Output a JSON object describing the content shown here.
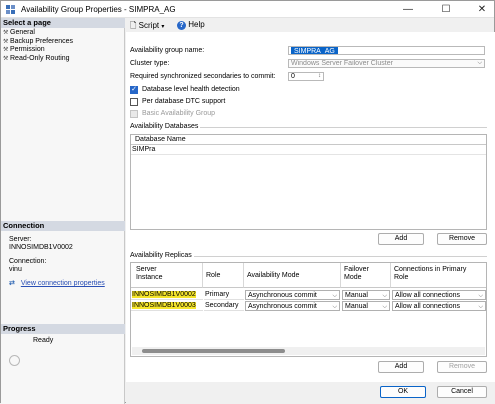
{
  "window": {
    "title": "Availability Group Properties - SIMPRA_AG",
    "minimize": "—",
    "maximize": "☐",
    "close": "✕"
  },
  "left": {
    "select_page_header": "Select a page",
    "pages": [
      {
        "label": "General",
        "icon": "wrench-icon"
      },
      {
        "label": "Backup Preferences",
        "icon": "wrench-icon"
      },
      {
        "label": "Permission",
        "icon": "wrench-icon"
      },
      {
        "label": "Read-Only Routing",
        "icon": "wrench-icon"
      }
    ],
    "connection_header": "Connection",
    "server_label": "Server:",
    "server_value": "INNOSIMDB1V0002",
    "connection_label": "Connection:",
    "connection_value": "vinu",
    "view_conn_link": "View connection properties",
    "progress_header": "Progress",
    "progress_status": "Ready"
  },
  "toolbar": {
    "script_label": "Script",
    "help_label": "Help"
  },
  "general": {
    "ag_name_label": "Availability group name:",
    "ag_name_value": "SIMPRA_AG",
    "cluster_type_label": "Cluster type:",
    "cluster_type_value": "Windows Server Failover Cluster",
    "req_sync_label": "Required synchronized secondaries to commit:",
    "req_sync_value": "0",
    "db_health_label": "Database level health detection",
    "db_health_checked": true,
    "dtc_label": "Per database DTC support",
    "dtc_checked": false,
    "basic_ag_label": "Basic Availability Group",
    "basic_ag_checked": false
  },
  "databases": {
    "section_label": "Availability Databases",
    "column": "Database Name",
    "rows": [
      "SIMPra"
    ],
    "add_button": "Add",
    "remove_button": "Remove"
  },
  "replicas": {
    "section_label": "Availability Replicas",
    "headers": {
      "server_instance": "Server\nInstance",
      "role": "Role",
      "availability_mode": "Availability Mode",
      "failover_mode": "Failover\nMode",
      "connections": "Connections in Primary\nRole"
    },
    "rows": [
      {
        "server": "INNOSIMDB1V0002",
        "role": "Primary",
        "mode": "Asynchronous commit",
        "failover": "Manual",
        "connections": "Allow all connections"
      },
      {
        "server": "INNOSIMDB1V0003",
        "role": "Secondary",
        "mode": "Asynchronous commit",
        "failover": "Manual",
        "connections": "Allow all connections"
      }
    ],
    "add_button": "Add",
    "remove_button": "Remove"
  },
  "footer": {
    "ok_button": "OK",
    "cancel_button": "Cancel"
  },
  "colors": {
    "highlight": "#f5e52a",
    "selection": "#0a64c8",
    "link": "#2a4fb5",
    "section_header": "#d4d9e2"
  }
}
